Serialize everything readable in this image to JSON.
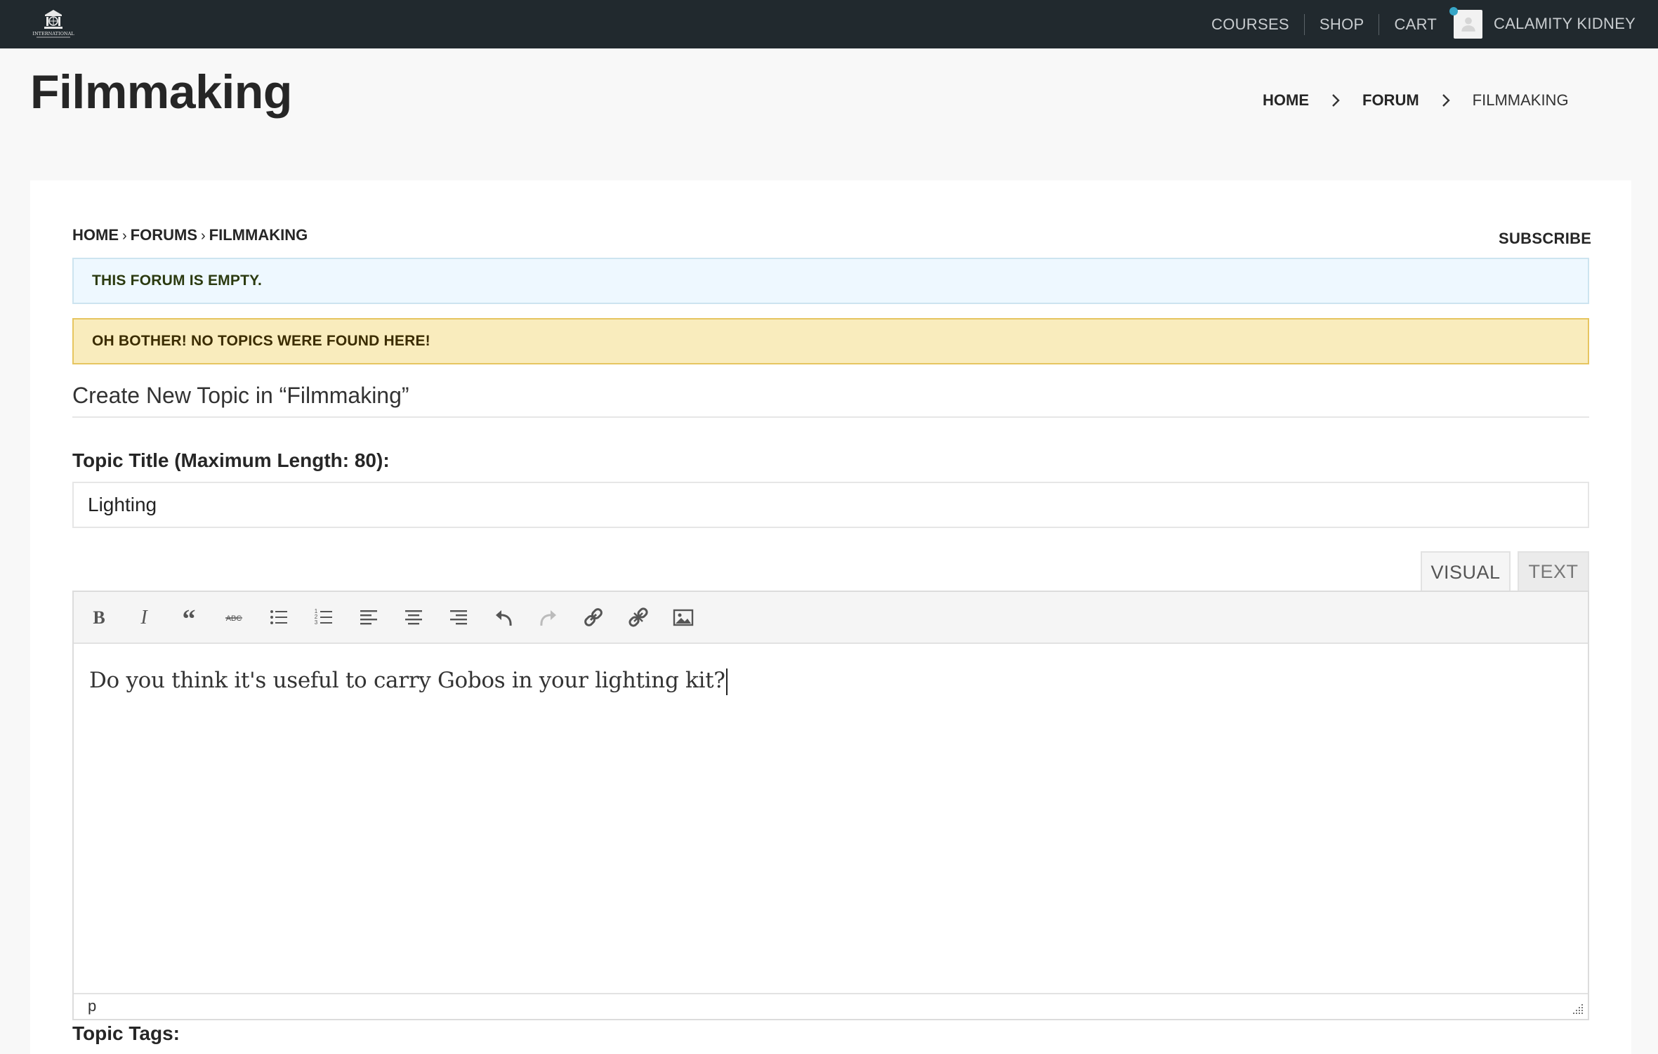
{
  "topbar": {
    "logo_text": "INTERNATIONAL",
    "nav": [
      {
        "label": "COURSES"
      },
      {
        "label": "SHOP"
      },
      {
        "label": "CART"
      }
    ],
    "user_name": "CALAMITY KIDNEY"
  },
  "header": {
    "title": "Filmmaking",
    "breadcrumb": {
      "home": "HOME",
      "forum": "FORUM",
      "current": "FILMMAKING"
    }
  },
  "forum": {
    "breadcrumb": {
      "home": "HOME",
      "forums": "FORUMS",
      "current": "FILMMAKING",
      "separator": "›"
    },
    "subscribe_label": "SUBSCRIBE",
    "notice_info": "THIS FORUM IS EMPTY.",
    "notice_warning": "OH BOTHER! NO TOPICS WERE FOUND HERE!"
  },
  "new_topic": {
    "heading": "Create New Topic in “Filmmaking”",
    "title_label": "Topic Title (Maximum Length: 80):",
    "title_value": "Lighting",
    "editor": {
      "tabs": [
        {
          "label": "VISUAL",
          "active": true
        },
        {
          "label": "TEXT",
          "active": false
        }
      ],
      "toolbar": [
        "bold-icon",
        "italic-icon",
        "blockquote-icon",
        "strikethrough-icon",
        "bullet-list-icon",
        "numbered-list-icon",
        "align-left-icon",
        "align-center-icon",
        "align-right-icon",
        "undo-icon",
        "redo-icon",
        "link-icon",
        "unlink-icon",
        "image-icon"
      ],
      "content": "Do you think it's useful to carry Gobos in your lighting kit?",
      "path": "p"
    },
    "tags_label": "Topic Tags:"
  },
  "colors": {
    "topbar_bg": "#21292e",
    "info_bg": "#eef8ff",
    "warning_bg": "#f9ecbd",
    "warning_border": "#e6c560",
    "avatar_status_dot": "#37a6c7"
  }
}
